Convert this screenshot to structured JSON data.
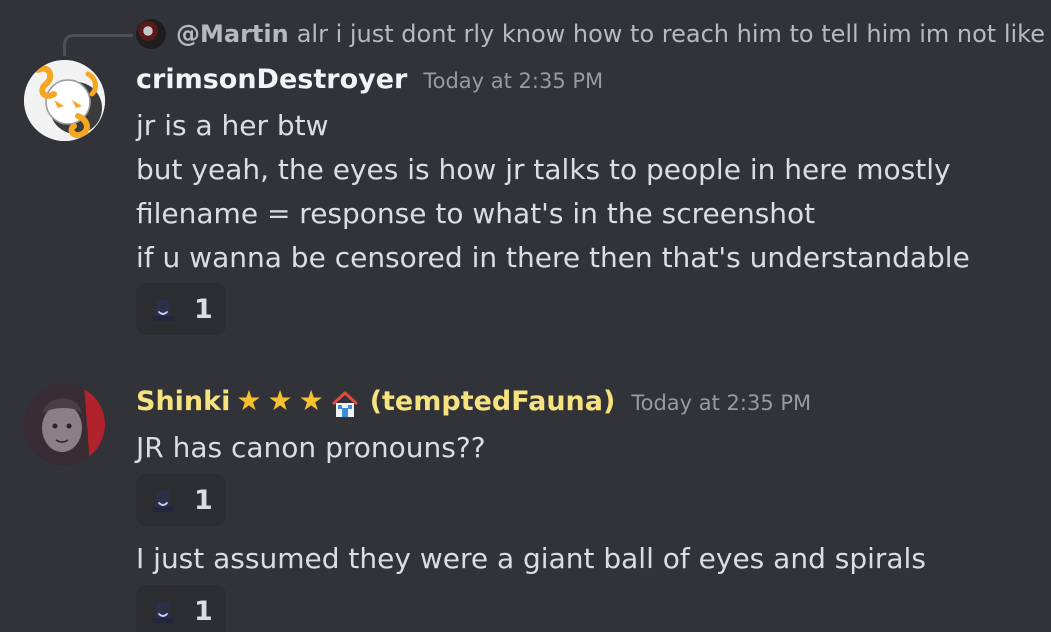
{
  "reply": {
    "author": "@Martin",
    "text": "alr i just dont rly know how to reach him to tell him im not like"
  },
  "messages": [
    {
      "author": "crimsonDestroyer",
      "timestamp": "Today at 2:35 PM",
      "lines": [
        "jr is a her btw",
        "but yeah, the eyes is how jr talks to people in here mostly",
        "filename = response to what's in the screenshot",
        "if u wanna be censored in there then that's understandable"
      ],
      "reaction": {
        "emoji": "dark-hat-emoji",
        "count": "1"
      }
    },
    {
      "author": "Shinki",
      "badges": [
        "★",
        "★",
        "★"
      ],
      "badge_extra": "house-icon",
      "author_suffix": "(temptedFauna)",
      "timestamp": "Today at 2:35 PM",
      "lines": [
        "JR has canon pronouns??"
      ],
      "reaction": {
        "emoji": "dark-hat-emoji",
        "count": "1"
      },
      "followup": {
        "lines": [
          "I just assumed they were a giant ball of eyes and spirals"
        ],
        "reaction": {
          "emoji": "dark-hat-emoji",
          "count": "1"
        }
      }
    }
  ],
  "colors": {
    "background": "#313338",
    "text": "#dbdee1",
    "muted": "#949ba4",
    "author_yellow": "#f6e27f",
    "reaction_bg": "#2b2d31"
  }
}
